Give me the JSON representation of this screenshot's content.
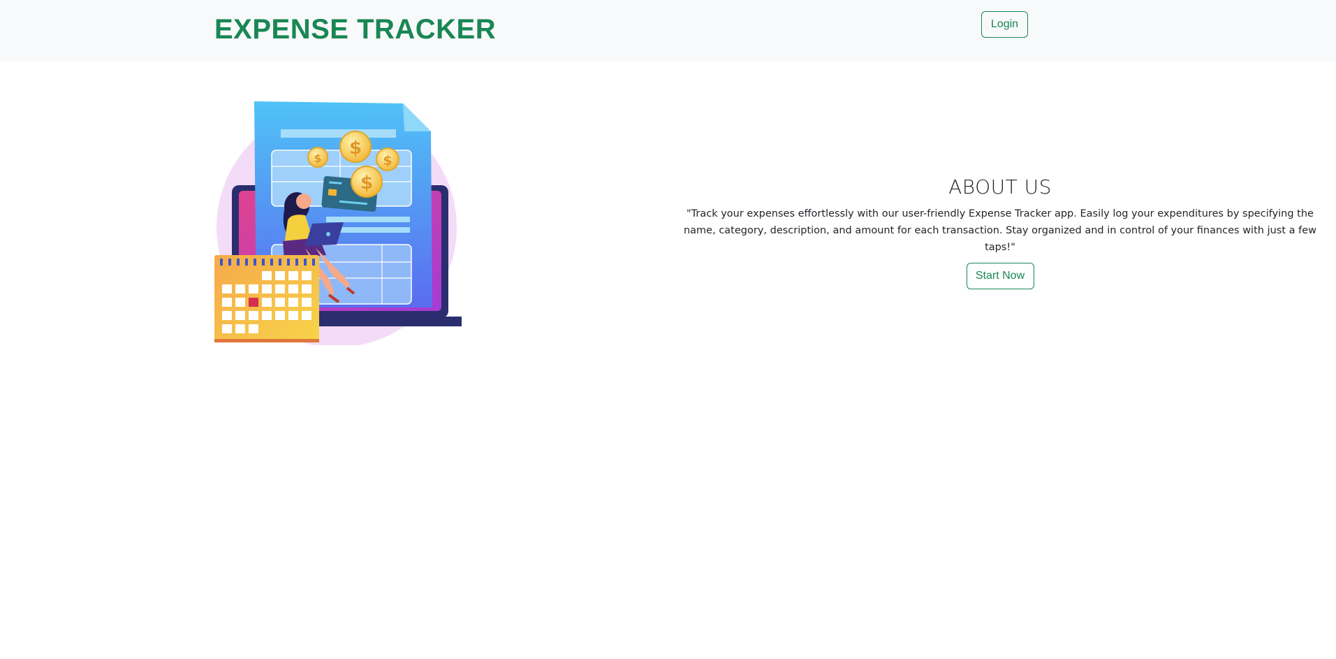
{
  "header": {
    "brand": "EXPENSE TRACKER",
    "login_label": "Login"
  },
  "about": {
    "title": "ABOUT US",
    "text": "\"Track your expenses effortlessly with our user-friendly Expense Tracker app. Easily log your expenditures by specifying the name, category, description, and amount for each transaction. Stay organized and in control of your finances with just a few taps!\"",
    "cta_label": "Start Now"
  },
  "illustration": {
    "coin_symbol": "$"
  },
  "colors": {
    "brand": "#198754",
    "navbar_bg": "#f8f9fa",
    "text": "#212529"
  }
}
